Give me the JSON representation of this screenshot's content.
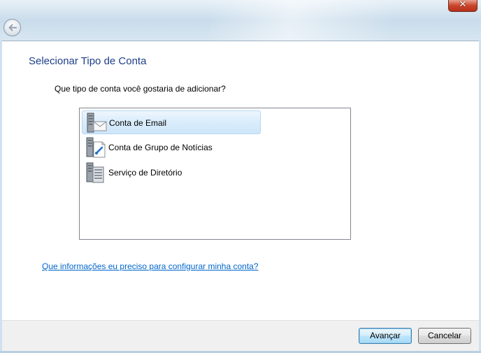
{
  "window": {
    "close_label": "✕"
  },
  "page": {
    "heading": "Selecionar Tipo de Conta",
    "question": "Que tipo de conta você gostaria de adicionar?",
    "help_link": "Que informações eu preciso para configurar minha conta?"
  },
  "account_types": [
    {
      "label": "Conta de Email",
      "icon": "email-server-icon",
      "selected": true
    },
    {
      "label": "Conta de Grupo de Notícias",
      "icon": "newsgroup-server-icon",
      "selected": false
    },
    {
      "label": "Serviço de Diretório",
      "icon": "directory-server-icon",
      "selected": false
    }
  ],
  "buttons": {
    "next": "Avançar",
    "cancel": "Cancelar"
  },
  "colors": {
    "heading": "#1e3e8a",
    "link": "#0066cc",
    "selection": "#cfe6fa"
  }
}
